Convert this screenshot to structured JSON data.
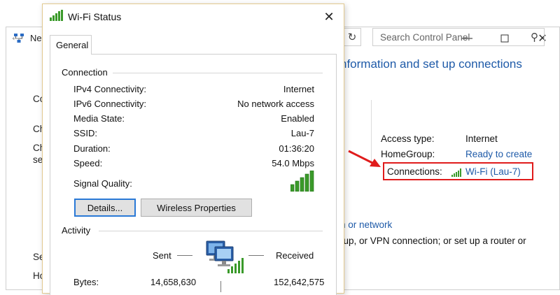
{
  "background_window": {
    "title_fragment": "Ne",
    "heading": "nformation and set up connections",
    "search_placeholder": "Search Control Panel",
    "left_fragments": [
      "Co",
      "Ch",
      "Ch",
      "set",
      "Se",
      "Ho"
    ],
    "access_type_label": "Access type:",
    "access_type_value": "Internet",
    "homegroup_label": "HomeGroup:",
    "homegroup_value": "Ready to create",
    "connections_label": "Connections:",
    "connections_value": "Wi-Fi (Lau-7)",
    "link_fragment": "n or network",
    "text_fragment": "-up, or VPN connection; or set up a router or"
  },
  "dialog": {
    "title": "Wi-Fi Status",
    "tab": "General",
    "connection_group": "Connection",
    "rows": [
      {
        "label": "IPv4 Connectivity:",
        "value": "Internet"
      },
      {
        "label": "IPv6 Connectivity:",
        "value": "No network access"
      },
      {
        "label": "Media State:",
        "value": "Enabled"
      },
      {
        "label": "SSID:",
        "value": "Lau-7"
      },
      {
        "label": "Duration:",
        "value": "01:36:20"
      },
      {
        "label": "Speed:",
        "value": "54.0 Mbps"
      }
    ],
    "signal_label": "Signal Quality:",
    "signal_bars": 5,
    "details_button": "Details...",
    "wireless_button": "Wireless Properties",
    "activity_group": "Activity",
    "sent_label": "Sent",
    "received_label": "Received",
    "bytes_label": "Bytes:",
    "bytes_sent": "14,658,630",
    "bytes_received": "152,642,575"
  },
  "colors": {
    "accent": "#1e5aa8",
    "highlight_box": "#e01b1b",
    "signal_green": "#3a9a2a"
  }
}
